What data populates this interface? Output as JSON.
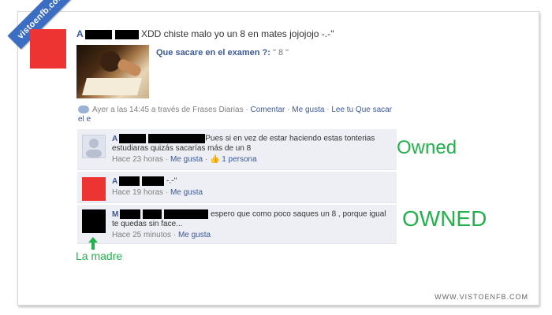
{
  "site": {
    "ribbon": "vistoenfb.com",
    "watermark": "WWW.VISTOENFB.COM"
  },
  "post": {
    "author_initial": "A",
    "text": "XDD chiste malo yo un 8 en mates jojojojo -.-''",
    "app_question": "Que sacare en el examen ?:",
    "app_answer": "\" 8 \"",
    "meta_time": "Ayer a las 14:45 a través de Frases Diarias",
    "sep": "·",
    "comment_link": "Comentar",
    "like_link": "Me gusta",
    "read_link": "Lee tu Que sacar",
    "read_link_cont": "el e"
  },
  "comments": [
    {
      "initial": "A",
      "text": "Pues si en vez de estar haciendo estas tonterias estudiaras quizás sacarías más de un 8",
      "time": "Hace 23 horas",
      "like": "Me gusta",
      "likes_count": "1 persona",
      "avatar_color": "#dfe3ee"
    },
    {
      "initial": "A",
      "text": "-.-''",
      "time": "Hace 19 horas",
      "like": "Me gusta",
      "avatar_color": "#ee3333"
    },
    {
      "initial": "M",
      "text": "espero que como poco saques un 8 , porque igual te quedas sin face...",
      "time": "Hace 25 minutos",
      "like": "Me gusta",
      "avatar_color": "#000000"
    }
  ],
  "annotations": {
    "owned_small": "Owned",
    "owned_big": "OWNED",
    "mother_label": "La madre",
    "accent_color": "#22b14c"
  }
}
